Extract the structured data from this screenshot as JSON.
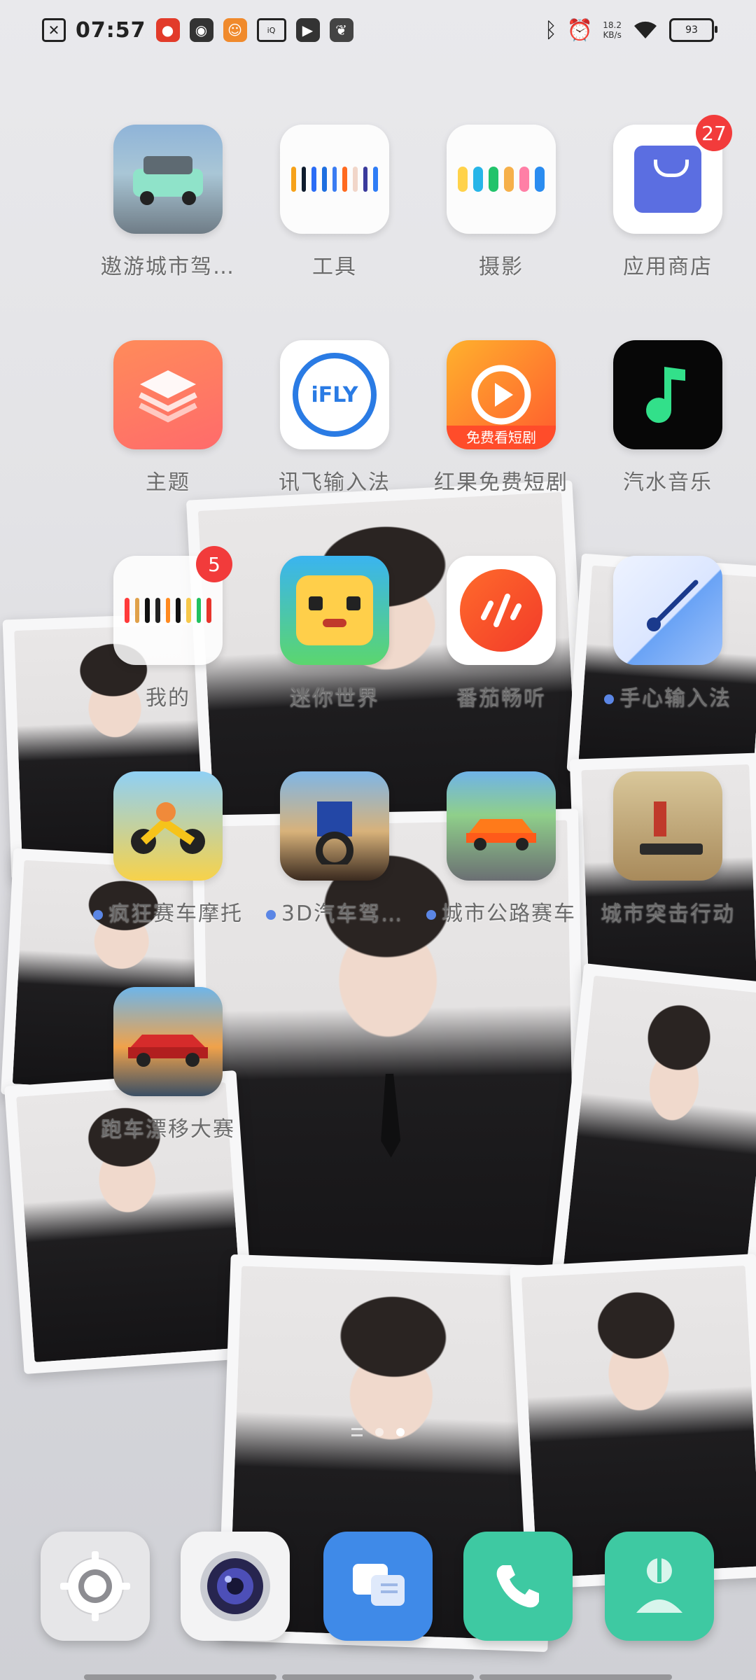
{
  "status_bar": {
    "time": "07:57",
    "net_speed": "18.2",
    "net_unit": "KB/s",
    "battery": "93",
    "left_icons": [
      "sim-x-icon",
      "app-notify-icon",
      "wechat-icon",
      "game-icon",
      "iqiyi-icon",
      "video-icon",
      "leaf-icon"
    ],
    "right_icons": [
      "bluetooth-icon",
      "alarm-icon",
      "wifi-icon",
      "battery-icon"
    ]
  },
  "apps": [
    {
      "id": "city-drive",
      "label": "遨游城市驾…",
      "icon": "car-game-icon",
      "dot": false
    },
    {
      "id": "tools",
      "label": "工具",
      "icon": "tools-folder-icon",
      "dot": false
    },
    {
      "id": "photo",
      "label": "摄影",
      "icon": "photo-folder-icon",
      "dot": false
    },
    {
      "id": "app-store",
      "label": "应用商店",
      "icon": "store-bag-icon",
      "badge": "27",
      "dot": false
    },
    {
      "id": "themes",
      "label": "主题",
      "icon": "layers-icon",
      "dot": false
    },
    {
      "id": "ifly",
      "label": "讯飞输入法",
      "icon": "ifly-icon",
      "icon_text": "iFLY",
      "dot": false
    },
    {
      "id": "hongguo",
      "label": "红果免费短剧",
      "icon": "play-icon",
      "icon_text": "免费看短剧",
      "dot": false
    },
    {
      "id": "qishui",
      "label": "汽水音乐",
      "icon": "music-note-icon",
      "dot": false
    },
    {
      "id": "mine",
      "label": "我的",
      "icon": "apps-folder-icon",
      "badge": "5",
      "dot": false
    },
    {
      "id": "mini-world",
      "label": "迷你世界",
      "icon": "mini-world-icon",
      "dot": false
    },
    {
      "id": "fanqie",
      "label": "番茄畅听",
      "icon": "audio-wave-icon",
      "dot": false
    },
    {
      "id": "shouxin",
      "label": "手心输入法",
      "icon": "clock-hand-icon",
      "dot": true
    },
    {
      "id": "moto-race",
      "label": "疯狂赛车摩托",
      "icon": "motorbike-icon",
      "dot": true
    },
    {
      "id": "truck-3d",
      "label": "3D汽车驾…",
      "icon": "truck-icon",
      "dot": true
    },
    {
      "id": "city-race",
      "label": "城市公路赛车",
      "icon": "race-car-icon",
      "dot": true
    },
    {
      "id": "city-assault",
      "label": "城市突击行动",
      "icon": "shooter-icon",
      "dot": false
    },
    {
      "id": "drift",
      "label": "跑车漂移大赛",
      "icon": "sports-car-icon",
      "dot": false
    }
  ],
  "dock": [
    {
      "id": "settings",
      "icon": "gear-icon"
    },
    {
      "id": "camera",
      "icon": "camera-icon"
    },
    {
      "id": "messages",
      "icon": "chat-bubble-icon"
    },
    {
      "id": "phone",
      "icon": "phone-icon"
    },
    {
      "id": "contacts",
      "icon": "person-icon"
    }
  ],
  "colors": {
    "badge": "#f23b3b",
    "dot": "#5b86e5",
    "store_bag": "#5b6ee1",
    "ifly_blue": "#2a7be4",
    "hongguo_orange": "#ff6a2b",
    "qishui_green": "#32e08a",
    "phone_green": "#3ec9a2",
    "messages_blue": "#3f8ae8"
  }
}
